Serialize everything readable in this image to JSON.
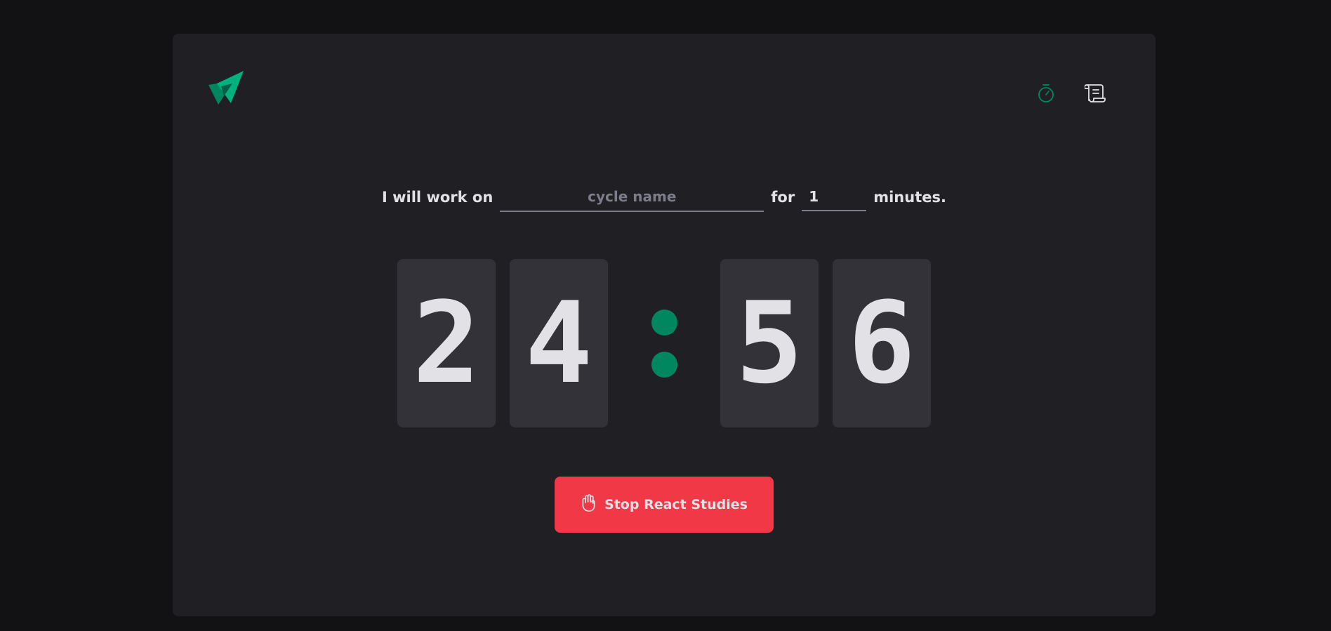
{
  "header": {
    "logo": "ignite-logo",
    "nav": [
      {
        "icon": "timer-icon",
        "active": true
      },
      {
        "icon": "scroll-icon",
        "active": false
      }
    ]
  },
  "form": {
    "prefix": "I will work on",
    "task_placeholder": "cycle name",
    "task_value": "",
    "for_label": "for",
    "minutes_value": "1",
    "suffix": "minutes."
  },
  "countdown": {
    "minutes_tens": "2",
    "minutes_ones": "4",
    "seconds_tens": "5",
    "seconds_ones": "6"
  },
  "stop_button": {
    "label": "Stop React Studies",
    "icon": "hand-palm-icon"
  },
  "colors": {
    "background": "#121214",
    "card": "#202024",
    "digit_bg": "#323238",
    "accent_green": "#00875f",
    "stop_red": "#f03847",
    "text": "#e1e1e6",
    "muted": "#7c7c8a"
  }
}
